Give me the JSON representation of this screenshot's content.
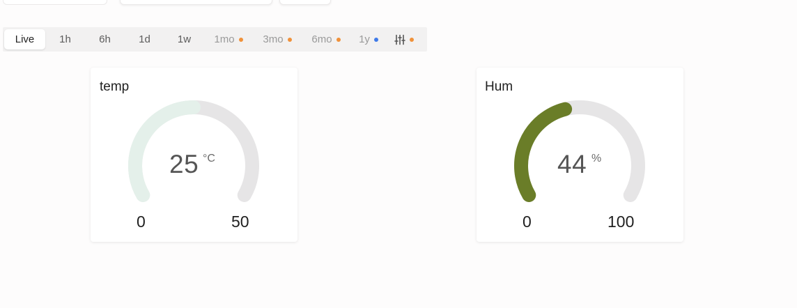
{
  "colors": {
    "temp_arc": "#e4f0ea",
    "hum_arc": "#6a7d28",
    "track": "#e6e5e6",
    "dot_orange": "#f0913a",
    "dot_blue": "#3f7ae8"
  },
  "range_bar": {
    "items": [
      {
        "label": "Live",
        "state": "active",
        "dot": null
      },
      {
        "label": "1h",
        "state": "normal",
        "dot": null
      },
      {
        "label": "6h",
        "state": "normal",
        "dot": null
      },
      {
        "label": "1d",
        "state": "normal",
        "dot": null
      },
      {
        "label": "1w",
        "state": "normal",
        "dot": null
      },
      {
        "label": "1mo",
        "state": "disabled",
        "dot": "orange"
      },
      {
        "label": "3mo",
        "state": "disabled",
        "dot": "orange"
      },
      {
        "label": "6mo",
        "state": "disabled",
        "dot": "orange"
      },
      {
        "label": "1y",
        "state": "disabled",
        "dot": "blue"
      },
      {
        "label": "",
        "icon": "sliders-icon",
        "state": "normal",
        "dot": "orange"
      }
    ]
  },
  "widgets": {
    "temp": {
      "title": "temp",
      "value": "25",
      "unit": "°C",
      "min": "0",
      "max": "50",
      "value_num": 25,
      "min_num": 0,
      "max_num": 50
    },
    "hum": {
      "title": "Hum",
      "value": "44",
      "unit": "%",
      "min": "0",
      "max": "100",
      "value_num": 44,
      "min_num": 0,
      "max_num": 100
    }
  }
}
